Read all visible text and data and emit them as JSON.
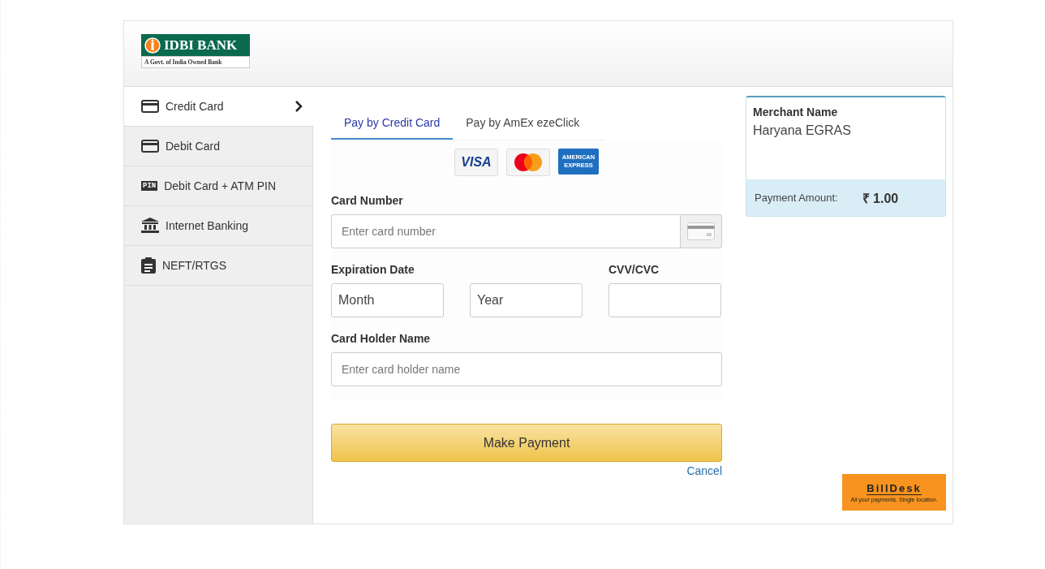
{
  "header": {
    "logo": {
      "name": "IDBI BANK",
      "tagline": "A Govt. of India Owned Bank"
    }
  },
  "sidebar": {
    "items": [
      {
        "label": "Credit Card",
        "kind": "card",
        "selected": true
      },
      {
        "label": "Debit Card",
        "kind": "card",
        "selected": false
      },
      {
        "label": "Debit Card + ATM PIN",
        "kind": "pin",
        "icon_text": "PIN",
        "selected": false
      },
      {
        "label": "Internet Banking",
        "kind": "bank",
        "selected": false
      },
      {
        "label": "NEFT/RTGS",
        "kind": "clipboard",
        "selected": false
      }
    ]
  },
  "tabs": [
    {
      "label": "Pay by Credit Card",
      "selected": true
    },
    {
      "label": "Pay by AmEx ezeClick",
      "selected": false
    }
  ],
  "card_logos": {
    "visa": "VISA",
    "amex": [
      "AMERICAN",
      "EXPRESS"
    ]
  },
  "form": {
    "card_number": {
      "label": "Card Number",
      "placeholder": "Enter card number"
    },
    "expiration": {
      "label": "Expiration Date",
      "month": {
        "placeholder": "Month"
      },
      "year": {
        "placeholder": "Year"
      }
    },
    "cvv": {
      "label": "CVV/CVC"
    },
    "holder": {
      "label": "Card Holder Name",
      "placeholder": "Enter card holder name"
    }
  },
  "actions": {
    "submit": "Make Payment",
    "cancel": "Cancel"
  },
  "summary": {
    "merchant_label": "Merchant Name",
    "merchant": "Haryana EGRAS",
    "amount_label": "Payment Amount:",
    "amount": "₹ 1.00"
  },
  "billdesk": {
    "name": "BillDesk",
    "tagline": "All your payments. Single location."
  }
}
